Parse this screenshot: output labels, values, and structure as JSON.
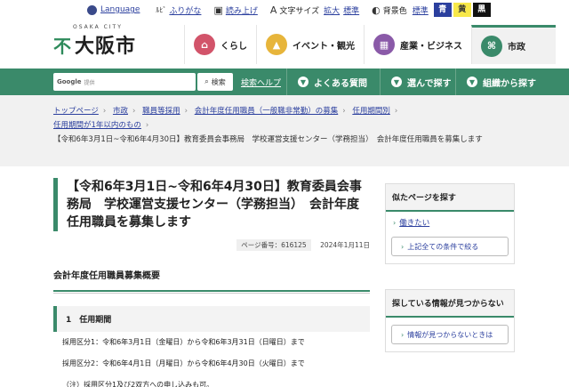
{
  "utility": {
    "language": "Language",
    "furigana_glyph": "ﾙﾋﾞ",
    "furigana": "ふりがな",
    "read_aloud": "読み上げ",
    "font_size_label": "文字サイズ",
    "font_size_large": "拡大",
    "font_size_standard": "標準",
    "bg_color_label": "背景色",
    "bg_standard": "標準",
    "bg_blue": "青",
    "bg_yellow": "黄",
    "bg_black": "黒"
  },
  "header": {
    "logo_sub": "OSAKA CITY",
    "logo_text": "大阪市",
    "nav": [
      {
        "label": "くらし",
        "icon": "house-icon",
        "color": "#d2546a"
      },
      {
        "label": "イベント・観光",
        "icon": "tower-icon",
        "color": "#e7b53b"
      },
      {
        "label": "産業・ビジネス",
        "icon": "building-icon",
        "color": "#8a5aa8"
      },
      {
        "label": "市政",
        "icon": "city-icon",
        "color": "#3a8a6a"
      }
    ]
  },
  "search": {
    "google_label": "Google",
    "google_sub": "提供",
    "button": "検索",
    "help": "検索ヘルプ",
    "faq": "よくある質問",
    "choose": "選んで探す",
    "org": "組織から探す"
  },
  "breadcrumb": {
    "items": [
      "トップページ",
      "市政",
      "職員等採用",
      "会計年度任用職員（一般職非常勤）の募集",
      "任用期間別",
      "任用期間が1年以内のもの"
    ],
    "current": "【令和6年3月1日~令和6年4月30日】教育委員会事務局　学校運営支援センター（学務担当）　会計年度任用職員を募集します"
  },
  "main": {
    "title": "【令和6年3月1日~令和6年4月30日】教育委員会事務局　学校運営支援センター（学務担当）　会計年度任用職員を募集します",
    "page_no": "ページ番号：616125",
    "date": "2024年1月11日",
    "section": "会計年度任用職員募集概要",
    "subsection": "1　任用期間",
    "lines": [
      "採用区分1：令和6年3月1日（金曜日）から令和6年3月31日（日曜日）まで",
      "採用区分2：令和6年4月1日（月曜日）から令和6年4月30日（火曜日）まで",
      "（注）採用区分1及び2双方への申し込みも可。"
    ]
  },
  "sidebar": {
    "similar_heading": "似たページを探す",
    "similar_link": "働きたい",
    "similar_button": "上記全ての条件で絞る",
    "notfound_heading": "探している情報が見つからない",
    "notfound_button": "情報が見つからないときは"
  }
}
